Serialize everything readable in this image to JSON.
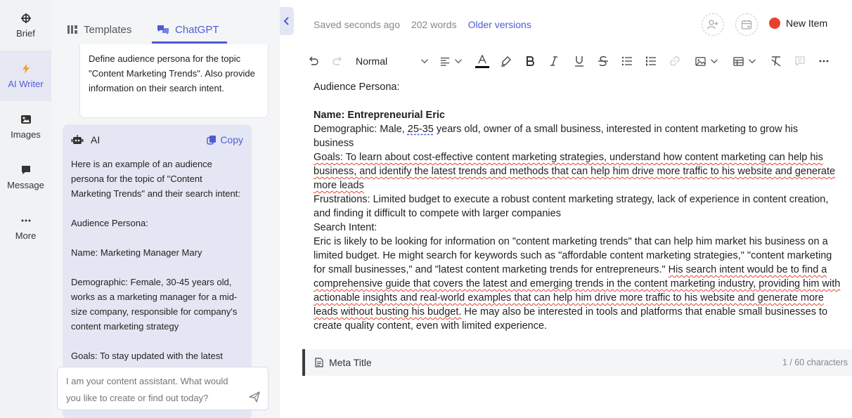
{
  "rail": {
    "items": [
      {
        "label": "Brief",
        "icon": "crosshair-icon"
      },
      {
        "label": "AI Writer",
        "icon": "lightning-icon"
      },
      {
        "label": "Images",
        "icon": "image-icon"
      },
      {
        "label": "Message",
        "icon": "message-icon"
      },
      {
        "label": "More",
        "icon": "more-dots-icon"
      }
    ]
  },
  "panel": {
    "tabs": [
      {
        "label": "Templates",
        "icon": "templates-icon"
      },
      {
        "label": "ChatGPT",
        "icon": "chat-bubbles-icon"
      }
    ],
    "user_message": "Define audience persona for the topic \"Content Marketing Trends\". Also provide information on their search intent.",
    "ai": {
      "name": "AI",
      "copy_label": "Copy",
      "body": "Here is an example of an audience persona for the topic of \"Content Marketing Trends\" and their search intent:\n\nAudience Persona:\n\nName: Marketing Manager Mary\n\nDemographic: Female, 30-45 years old, works as a marketing manager for a mid-size company, responsible for company's content marketing strategy\n\nGoals: To stay updated with the latest"
    },
    "input_placeholder": "I am your content assistant. What would you like to create or find out today?"
  },
  "editor": {
    "saved": "Saved seconds ago",
    "words": "202 words",
    "older_versions": "Older versions",
    "new_item": "New Item",
    "style_select": "Normal",
    "doc": {
      "heading": "Audience Persona:",
      "name": "Name: Entrepreneurial Eric",
      "demographic_a": "Demographic: Male, ",
      "demographic_age": "25-35",
      "demographic_b": " years old, owner of a small business, interested in content marketing to grow his business",
      "goals": "Goals: To learn about cost-effective content marketing strategies, understand how content marketing can help his business, and identify the latest trends and methods that can help him drive more traffic to his website and generate more leads",
      "frustrations": "Frustrations: Limited budget to execute a robust content marketing strategy, lack of experience in content creation, and finding it difficult to compete with larger companies",
      "search_intent_label": "Search Intent:",
      "search_a": "Eric is likely to be looking for information on \"content marketing trends\" that can help him market his business on a limited budget. He might search for keywords such as \"affordable content marketing strategies,\" \"content marketing for small businesses,\" and \"latest content marketing trends for entrepreneurs.\" ",
      "search_b": "His search intent would be to find a comprehensive guide that covers the latest and emerging trends in the content marketing industry, providing him with actionable insights and real-world examples that can help him drive more traffic to his website and generate more leads without busting his budget.",
      "search_c": " He may also be interested in tools and platforms that enable small businesses to create quality content, even with limited experience."
    },
    "meta": {
      "label": "Meta Title",
      "count": "1 / 60 characters"
    }
  },
  "colors": {
    "accent": "#4f5bd5",
    "red": "#e8412f",
    "rail_bg": "#f1f2f4"
  }
}
